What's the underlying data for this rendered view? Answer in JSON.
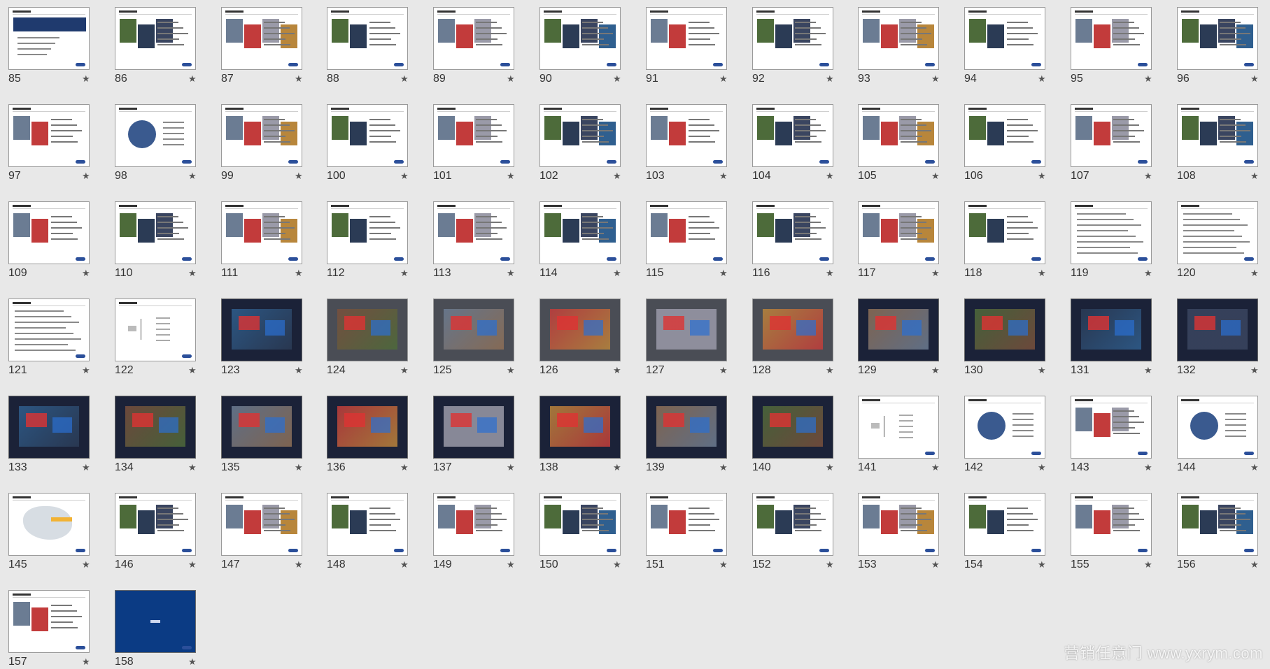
{
  "view": "slide-sorter",
  "colors": {
    "background": "#e8e8e8",
    "accent": "#2b4f9a"
  },
  "icons": {
    "star": "★",
    "star_name": "star-icon"
  },
  "slides": [
    {
      "number": "85",
      "type": "table"
    },
    {
      "number": "86",
      "type": "photo"
    },
    {
      "number": "87",
      "type": "photo"
    },
    {
      "number": "88",
      "type": "photo"
    },
    {
      "number": "89",
      "type": "photo"
    },
    {
      "number": "90",
      "type": "photo"
    },
    {
      "number": "91",
      "type": "photo"
    },
    {
      "number": "92",
      "type": "photo"
    },
    {
      "number": "93",
      "type": "photo"
    },
    {
      "number": "94",
      "type": "photo"
    },
    {
      "number": "95",
      "type": "photo"
    },
    {
      "number": "96",
      "type": "photo"
    },
    {
      "number": "97",
      "type": "photo"
    },
    {
      "number": "98",
      "type": "diagram"
    },
    {
      "number": "99",
      "type": "photo"
    },
    {
      "number": "100",
      "type": "photo"
    },
    {
      "number": "101",
      "type": "photo"
    },
    {
      "number": "102",
      "type": "photo"
    },
    {
      "number": "103",
      "type": "photo"
    },
    {
      "number": "104",
      "type": "photo"
    },
    {
      "number": "105",
      "type": "photo"
    },
    {
      "number": "106",
      "type": "photo"
    },
    {
      "number": "107",
      "type": "photo"
    },
    {
      "number": "108",
      "type": "photo"
    },
    {
      "number": "109",
      "type": "photo"
    },
    {
      "number": "110",
      "type": "photo"
    },
    {
      "number": "111",
      "type": "photo"
    },
    {
      "number": "112",
      "type": "photo"
    },
    {
      "number": "113",
      "type": "photo"
    },
    {
      "number": "114",
      "type": "photo"
    },
    {
      "number": "115",
      "type": "photo"
    },
    {
      "number": "116",
      "type": "photo"
    },
    {
      "number": "117",
      "type": "photo"
    },
    {
      "number": "118",
      "type": "photo"
    },
    {
      "number": "119",
      "type": "text"
    },
    {
      "number": "120",
      "type": "text"
    },
    {
      "number": "121",
      "type": "text"
    },
    {
      "number": "122",
      "type": "section"
    },
    {
      "number": "123",
      "type": "dark"
    },
    {
      "number": "124",
      "type": "grey"
    },
    {
      "number": "125",
      "type": "grey"
    },
    {
      "number": "126",
      "type": "grey"
    },
    {
      "number": "127",
      "type": "grey"
    },
    {
      "number": "128",
      "type": "grey"
    },
    {
      "number": "129",
      "type": "dark"
    },
    {
      "number": "130",
      "type": "dark"
    },
    {
      "number": "131",
      "type": "dark"
    },
    {
      "number": "132",
      "type": "dark"
    },
    {
      "number": "133",
      "type": "dark"
    },
    {
      "number": "134",
      "type": "dark"
    },
    {
      "number": "135",
      "type": "dark"
    },
    {
      "number": "136",
      "type": "dark"
    },
    {
      "number": "137",
      "type": "dark"
    },
    {
      "number": "138",
      "type": "dark"
    },
    {
      "number": "139",
      "type": "dark"
    },
    {
      "number": "140",
      "type": "dark"
    },
    {
      "number": "141",
      "type": "section"
    },
    {
      "number": "142",
      "type": "diagram"
    },
    {
      "number": "143",
      "type": "photo"
    },
    {
      "number": "144",
      "type": "diagram"
    },
    {
      "number": "145",
      "type": "map"
    },
    {
      "number": "146",
      "type": "photo"
    },
    {
      "number": "147",
      "type": "photo"
    },
    {
      "number": "148",
      "type": "photo"
    },
    {
      "number": "149",
      "type": "photo"
    },
    {
      "number": "150",
      "type": "photo"
    },
    {
      "number": "151",
      "type": "photo"
    },
    {
      "number": "152",
      "type": "photo"
    },
    {
      "number": "153",
      "type": "photo"
    },
    {
      "number": "154",
      "type": "photo"
    },
    {
      "number": "155",
      "type": "photo"
    },
    {
      "number": "156",
      "type": "photo"
    },
    {
      "number": "157",
      "type": "photo"
    },
    {
      "number": "158",
      "type": "navy"
    }
  ],
  "watermark": "营销任意门 www.yxrym.com"
}
